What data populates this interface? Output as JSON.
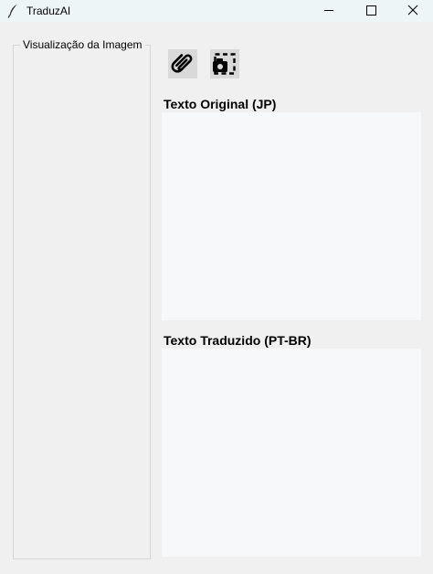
{
  "window": {
    "title": "TraduzAI",
    "icon": "feather-icon",
    "controls": [
      "minimize-icon",
      "maximize-icon",
      "close-icon"
    ]
  },
  "preview": {
    "label": "Visualização da Imagem"
  },
  "toolbar": {
    "attach_icon": "paperclip-icon",
    "capture_icon": "screen-capture-icon"
  },
  "original": {
    "label": "Texto Original (JP)",
    "value": ""
  },
  "translated": {
    "label": "Texto Traduzido (PT-BR)",
    "value": ""
  },
  "colors": {
    "titlebar_bg": "#eef5f6",
    "window_bg": "#f0f0f0",
    "textarea_bg": "#f7f8fa",
    "tool_button_bg": "#d9d9d9"
  }
}
